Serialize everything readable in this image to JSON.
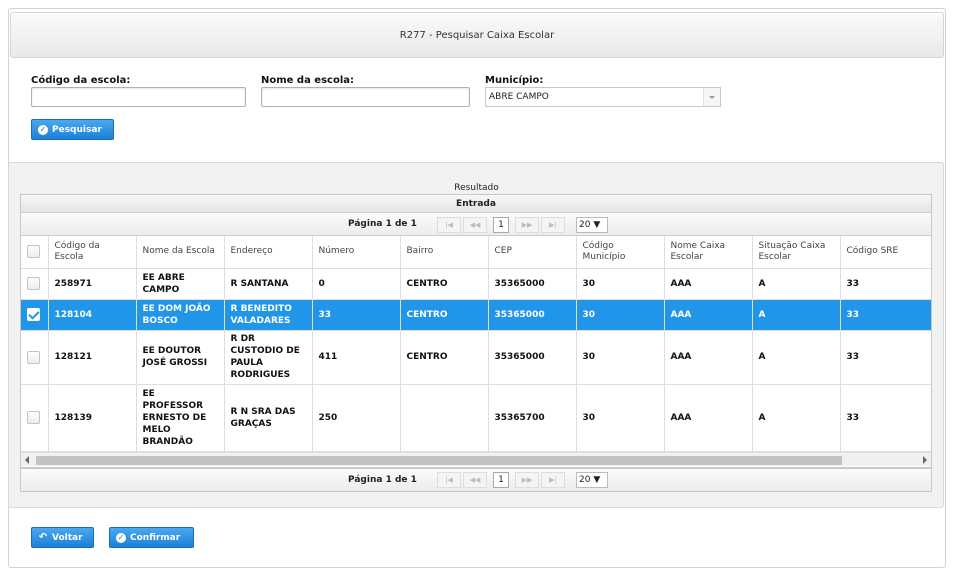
{
  "page": {
    "title": "R277 - Pesquisar Caixa Escolar"
  },
  "search": {
    "codigo_label": "Código da escola:",
    "codigo_value": "",
    "nome_label": "Nome da escola:",
    "nome_value": "",
    "municipio_label": "Município:",
    "municipio_value": "ABRE CAMPO",
    "pesquisar_label": "Pesquisar"
  },
  "results": {
    "caption": "Resultado",
    "grid_title": "Entrada",
    "pager_text": "Página 1 de 1",
    "page_number": "1",
    "page_size": "20 ▼",
    "columns": [
      "Código da Escola",
      "Nome da Escola",
      "Endereço",
      "Número",
      "Bairro",
      "CEP",
      "Código Município",
      "Nome Caixa Escolar",
      "Situação Caixa Escolar",
      "Código SRE"
    ],
    "rows": [
      {
        "selected": false,
        "cells": [
          "258971",
          "EE ABRE CAMPO",
          "R SANTANA",
          "0",
          "CENTRO",
          "35365000",
          "30",
          "AAA",
          "A",
          "33"
        ]
      },
      {
        "selected": true,
        "cells": [
          "128104",
          "EE DOM JOÃO BOSCO",
          "R BENEDITO VALADARES",
          "33",
          "CENTRO",
          "35365000",
          "30",
          "AAA",
          "A",
          "33"
        ]
      },
      {
        "selected": false,
        "cells": [
          "128121",
          "EE DOUTOR JOSÉ GROSSI",
          "R DR CUSTODIO DE PAULA RODRIGUES",
          "411",
          "CENTRO",
          "35365000",
          "30",
          "AAA",
          "A",
          "33"
        ]
      },
      {
        "selected": false,
        "cells": [
          "128139",
          "EE PROFESSOR ERNESTO DE MELO BRANDÃO",
          "R N SRA DAS GRAÇAS",
          "250",
          "",
          "35365700",
          "30",
          "AAA",
          "A",
          "33"
        ]
      }
    ]
  },
  "footer": {
    "voltar_label": "Voltar",
    "confirmar_label": "Confirmar"
  },
  "colors": {
    "accent": "#1b80d8",
    "selected_row": "#2196e8"
  }
}
